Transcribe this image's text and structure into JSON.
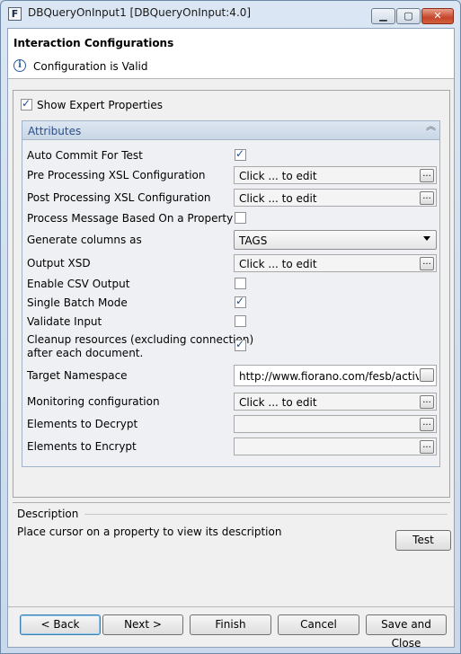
{
  "window": {
    "title": "DBQueryOnInput1 [DBQueryOnInput:4.0]",
    "icon_letter": "F",
    "controls": {
      "minimize": "▁",
      "maximize": "▢",
      "close": "✕"
    }
  },
  "header": {
    "title": "Interaction Configurations",
    "status": "Configuration is Valid",
    "info_glyph": "i"
  },
  "expert": {
    "label": "Show Expert Properties",
    "checked": true
  },
  "attributes": {
    "title": "Attributes",
    "collapse_glyph": "︽",
    "rows": [
      {
        "label": "Auto Commit For Test",
        "type": "checkbox",
        "checked": true
      },
      {
        "label": "Pre Processing XSL Configuration",
        "type": "editor",
        "value": "Click ... to edit"
      },
      {
        "label": "Post Processing XSL Configuration",
        "type": "editor",
        "value": "Click ... to edit"
      },
      {
        "label": "Process Message Based On a Property",
        "type": "checkbox",
        "checked": false
      },
      {
        "label": "Generate columns as",
        "type": "select",
        "value": "TAGS"
      },
      {
        "label": "Output XSD",
        "type": "editor",
        "value": "Click ... to edit"
      },
      {
        "label": "Enable CSV Output",
        "type": "checkbox",
        "checked": false
      },
      {
        "label": "Single Batch Mode",
        "type": "checkbox",
        "checked": true
      },
      {
        "label": "Validate Input",
        "type": "checkbox",
        "checked": false
      },
      {
        "label_line1": "Cleanup resources (excluding connection)",
        "label_line2": "after each document.",
        "type": "checkbox",
        "checked": true
      },
      {
        "label": "Target Namespace",
        "type": "text",
        "value": "http://www.fiorano.com/fesb/activit"
      },
      {
        "label": "Monitoring configuration",
        "type": "editor",
        "value": "Click ... to edit"
      },
      {
        "label": "Elements to Decrypt",
        "type": "editor",
        "value": ""
      },
      {
        "label": "Elements to Encrypt",
        "type": "editor",
        "value": ""
      }
    ],
    "dots_label": "..."
  },
  "description": {
    "title": "Description",
    "text": "Place cursor on a property to view its description"
  },
  "buttons": {
    "test": "Test",
    "back": "< Back",
    "next": "Next >",
    "finish": "Finish",
    "cancel": "Cancel",
    "save_close": "Save and Close"
  }
}
